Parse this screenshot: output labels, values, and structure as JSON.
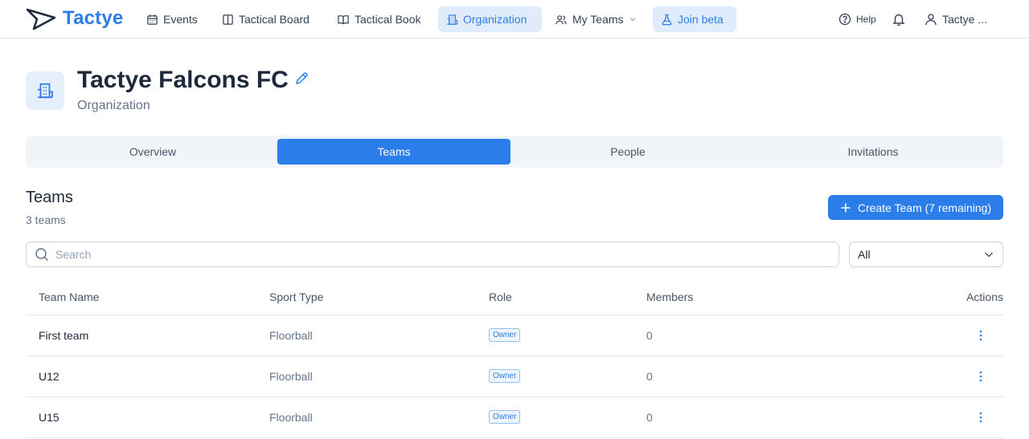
{
  "app": {
    "name": "Tactye"
  },
  "nav": {
    "events": "Events",
    "tactical_board": "Tactical Board",
    "tactical_book": "Tactical Book",
    "organization": "Organization",
    "my_teams": "My Teams",
    "join_beta": "Join beta",
    "help": "Help",
    "user": "Tactye ..."
  },
  "org": {
    "name": "Tactye Falcons FC",
    "subtitle": "Organization"
  },
  "tabs": [
    "Overview",
    "Teams",
    "People",
    "Invitations"
  ],
  "active_tab": "Teams",
  "section": {
    "title": "Teams",
    "count": "3 teams",
    "create_label": "Create Team (7 remaining)"
  },
  "search": {
    "placeholder": "Search",
    "value": ""
  },
  "filter": {
    "selected": "All"
  },
  "table": {
    "headers": {
      "name": "Team Name",
      "sport": "Sport Type",
      "role": "Role",
      "members": "Members",
      "actions": "Actions"
    },
    "rows": [
      {
        "name": "First team",
        "sport": "Floorball",
        "role": "Owner",
        "members": "0"
      },
      {
        "name": "U12",
        "sport": "Floorball",
        "role": "Owner",
        "members": "0"
      },
      {
        "name": "U15",
        "sport": "Floorball",
        "role": "Owner",
        "members": "0"
      }
    ]
  },
  "colors": {
    "accent": "#2b7de9",
    "text": "#1e293b",
    "muted": "#64748b"
  }
}
